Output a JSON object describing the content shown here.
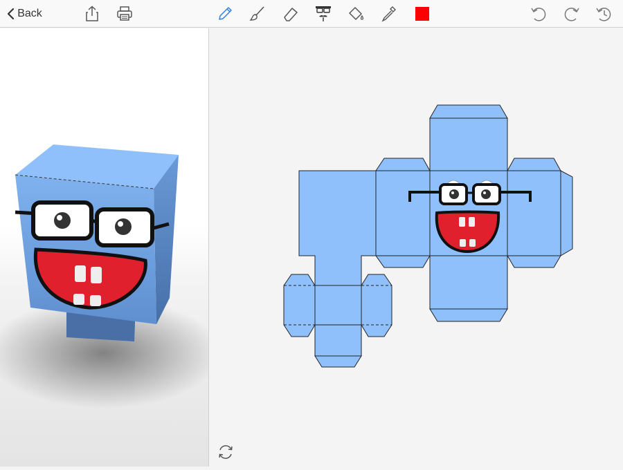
{
  "toolbar": {
    "back_label": "Back",
    "left_icons": [
      "share-icon",
      "print-icon"
    ],
    "tools": [
      "pencil-icon",
      "brush-icon",
      "eraser-icon",
      "mustache-glasses-icon",
      "paint-bucket-icon",
      "eyedropper-icon",
      "color-swatch"
    ],
    "active_tool": "pencil-icon",
    "current_color": "#ff0000",
    "right_icons": [
      "undo-icon",
      "redo-icon",
      "history-icon"
    ]
  },
  "colors": {
    "paper_blue": "#8fc0fb",
    "mouth_red": "#e0202c",
    "accent_blue": "#2f7fe0"
  },
  "preview": {
    "description_icon": "rotate-icon"
  }
}
